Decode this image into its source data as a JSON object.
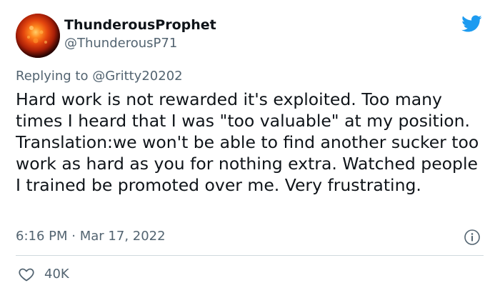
{
  "user": {
    "display_name": "ThunderousProphet",
    "handle": "@ThunderousP71",
    "avatar_icon": "sun-avatar"
  },
  "tweet": {
    "replying_label": "Replying to",
    "replying_to": "@Gritty20202",
    "text": "Hard work is not rewarded it's exploited. Too many times I heard that I was \"too valuable\" at my position. Translation:we won't be able to find another sucker too work as hard as you for nothing extra. Watched people I trained be promoted over me. Very frustrating.",
    "time": "6:16 PM",
    "separator": "·",
    "date": "Mar 17, 2022"
  },
  "actions": {
    "like_count": "40K"
  },
  "colors": {
    "brand": "#1d9bf0",
    "text_primary": "#0f1419",
    "text_secondary": "#536471",
    "divider": "#cfd9de"
  },
  "icons": {
    "brand": "twitter-bird-icon",
    "info": "info-icon",
    "like": "heart-icon"
  }
}
